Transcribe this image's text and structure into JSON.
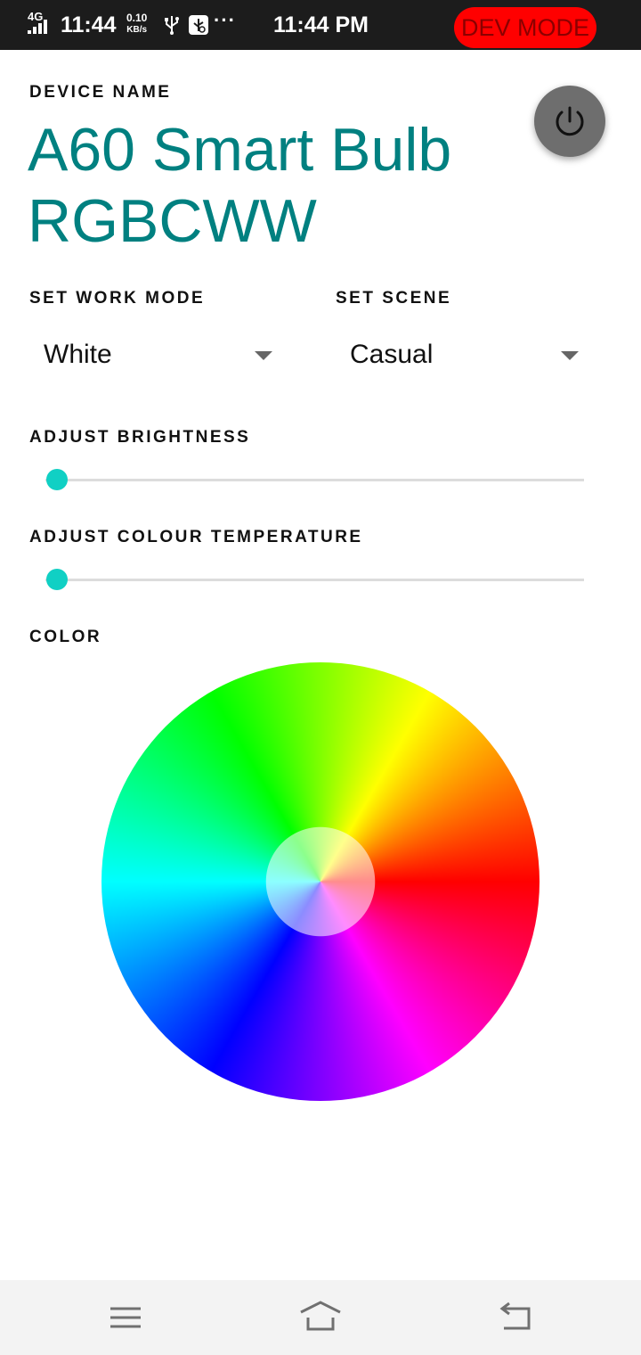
{
  "status_bar": {
    "network": "4G",
    "time_left": "11:44",
    "speed_value": "0.10",
    "speed_unit": "KB/s",
    "time_center": "11:44 PM",
    "dev_mode_label": "DEV MODE",
    "dev_mode_color": "#ff0000",
    "icons": [
      "signal-icon",
      "usb-icon",
      "usb-debugging-icon",
      "more-dots-icon"
    ]
  },
  "header": {
    "device_name_label": "DEVICE NAME",
    "device_name": "A60 Smart Bulb RGBCWW",
    "power_icon": "power-icon"
  },
  "controls": {
    "work_mode_label": "SET WORK MODE",
    "work_mode_value": "White",
    "scene_label": "SET SCENE",
    "scene_value": "Casual",
    "brightness_label": "ADJUST BRIGHTNESS",
    "brightness_value": 0,
    "colour_temp_label": "ADJUST COLOUR TEMPERATURE",
    "colour_temp_value": 0,
    "color_label": "COLOR"
  },
  "colors": {
    "accent": "#008080",
    "slider_thumb": "#10d0c4",
    "power_button": "#6e6e6e"
  },
  "nav_bar": {
    "icons": [
      "menu-icon",
      "home-icon",
      "back-icon"
    ]
  }
}
